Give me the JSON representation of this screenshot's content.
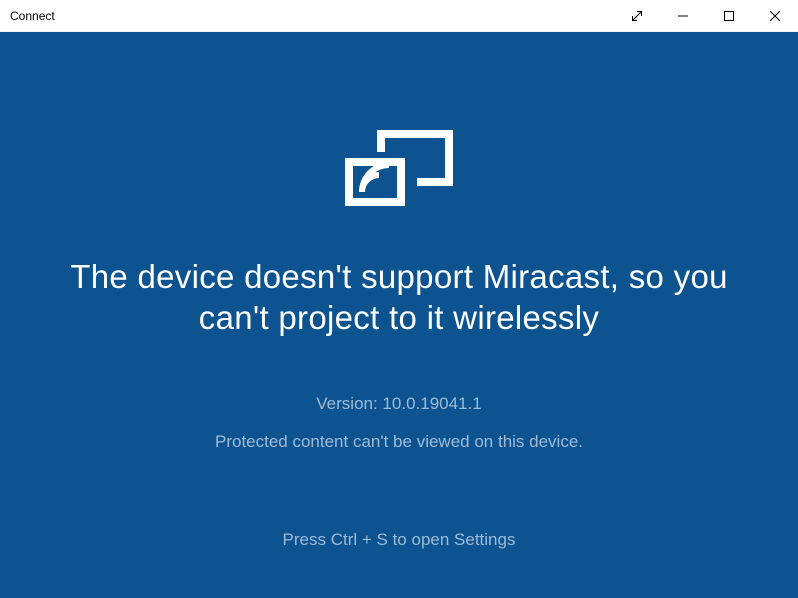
{
  "window": {
    "title": "Connect"
  },
  "main": {
    "heading": "The device doesn't support Miracast, so you can't project to it wirelessly",
    "version_label": "Version: 10.0.19041.1",
    "protected_notice": "Protected content can't be viewed on this device.",
    "settings_hint": "Press Ctrl + S to open Settings"
  },
  "colors": {
    "background": "#0C5390",
    "foreground": "#ffffff",
    "secondary_text": "#9dbbd6"
  }
}
